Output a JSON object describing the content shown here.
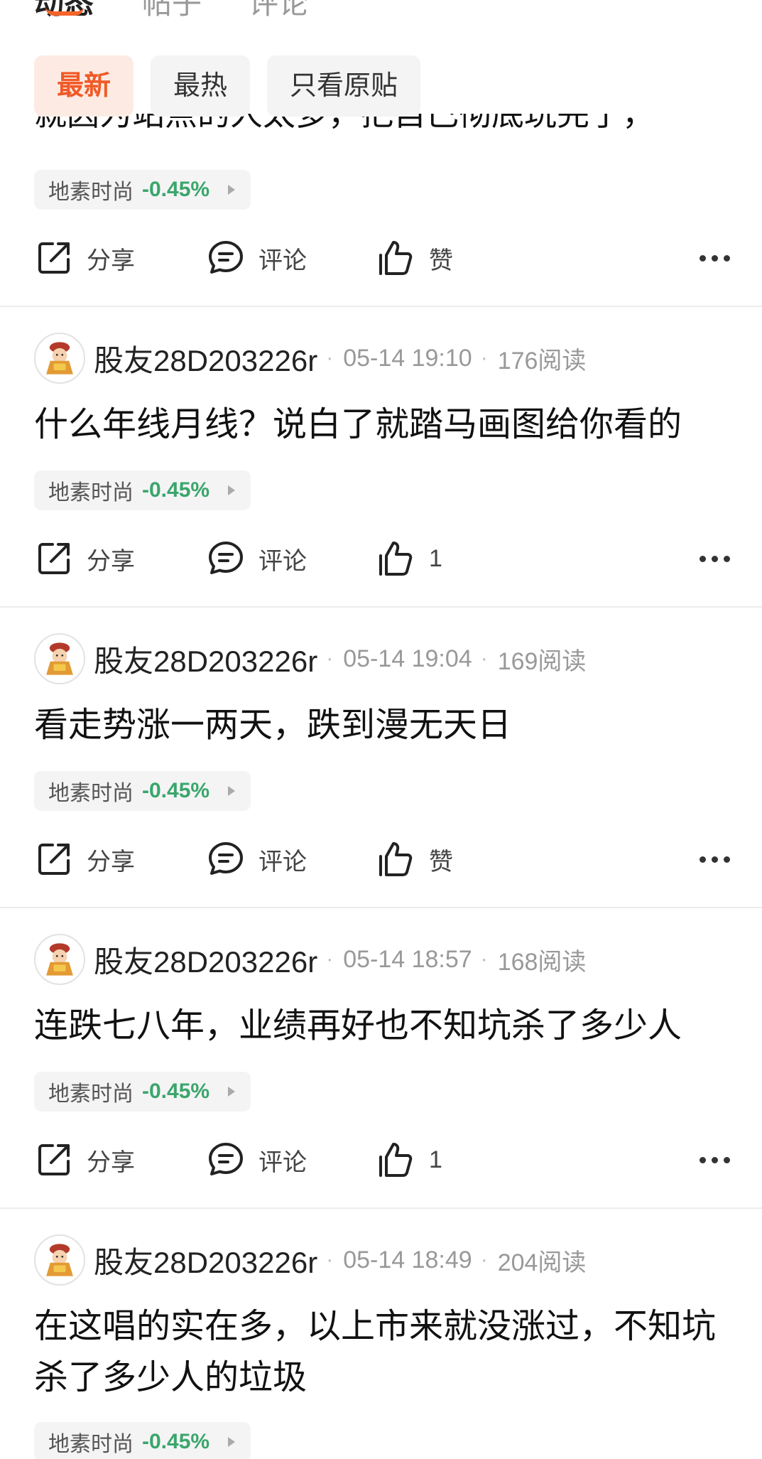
{
  "top_tabs": [
    "动态",
    "帖子",
    "评论"
  ],
  "filters": [
    "最新",
    "最热",
    "只看原贴"
  ],
  "partial_text": "就因为站点的人太多，把自己彻底玩完了，",
  "actions": {
    "share": "分享",
    "comment": "评论",
    "like": "赞"
  },
  "colors": {
    "accent": "#f05a28",
    "down": "#3aa66b"
  },
  "first_stock": {
    "name": "地素时尚",
    "change": "-0.45%"
  },
  "posts": [
    {
      "author": "股友28D203226r",
      "time": "05-14 19:10",
      "reads": "176阅读",
      "text": "什么年线月线？说白了就踏马画图给你看的",
      "stock": "地素时尚",
      "change": "-0.45%",
      "likes": "1"
    },
    {
      "author": "股友28D203226r",
      "time": "05-14 19:04",
      "reads": "169阅读",
      "text": "看走势涨一两天，跌到漫无天日",
      "stock": "地素时尚",
      "change": "-0.45%",
      "likes": "赞"
    },
    {
      "author": "股友28D203226r",
      "time": "05-14 18:57",
      "reads": "168阅读",
      "text": "连跌七八年，业绩再好也不知坑杀了多少人",
      "stock": "地素时尚",
      "change": "-0.45%",
      "likes": "1"
    },
    {
      "author": "股友28D203226r",
      "time": "05-14 18:49",
      "reads": "204阅读",
      "text": "在这唱的实在多，以上市来就没涨过，不知坑杀了多少人的垃圾",
      "stock": "地素时尚",
      "change": "-0.45%"
    }
  ]
}
